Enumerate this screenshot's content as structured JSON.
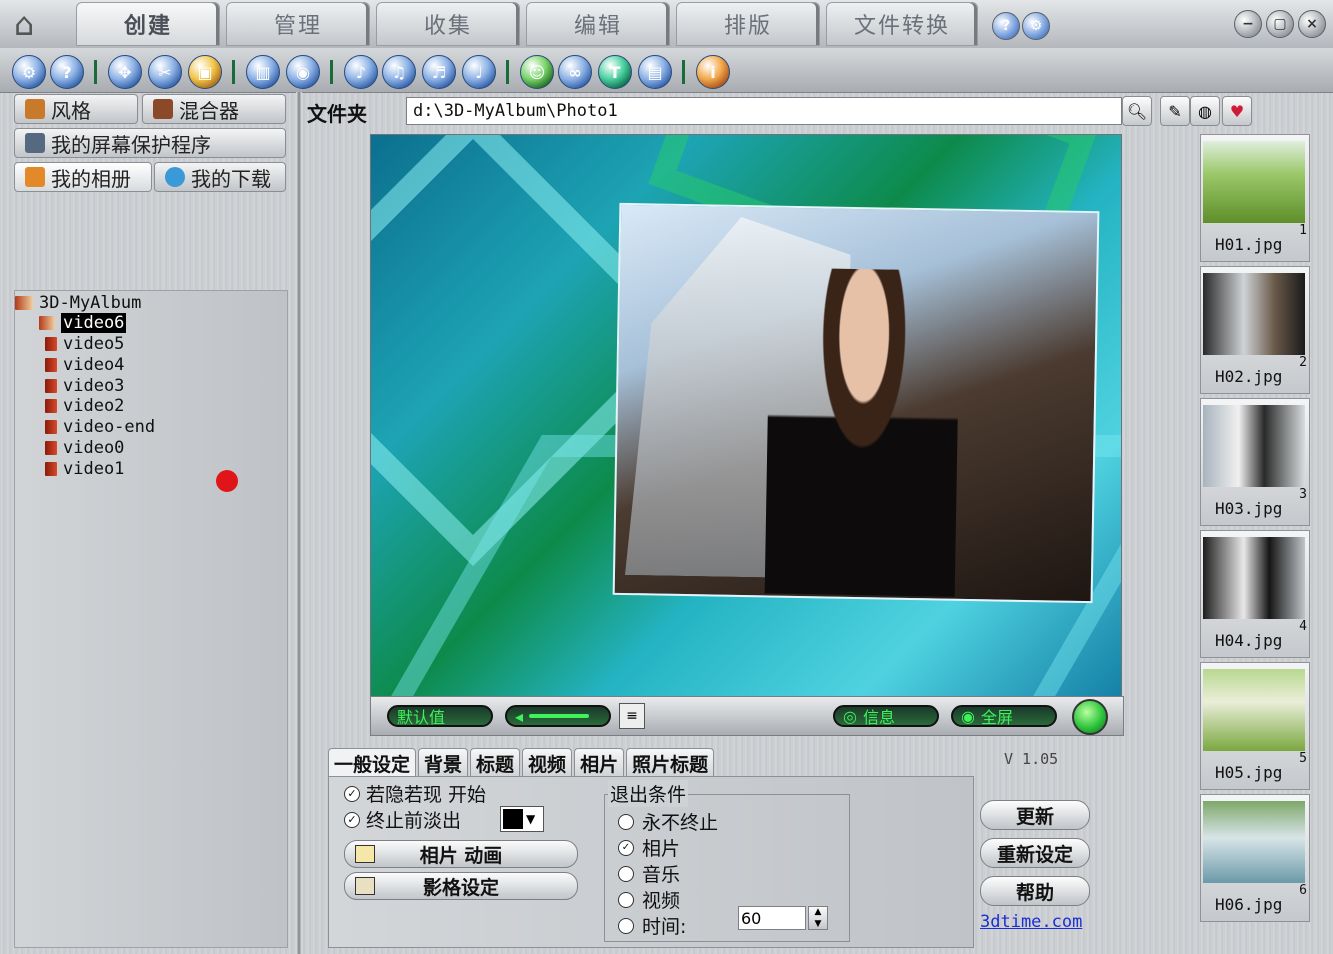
{
  "top_tabs": [
    "创建",
    "管理",
    "收集",
    "编辑",
    "排版",
    "文件转换"
  ],
  "left": {
    "btn_style": "风格",
    "btn_mixer": "混合器",
    "btn_screensaver": "我的屏幕保护程序",
    "btn_albums": "我的相册",
    "btn_downloads": "我的下载"
  },
  "tree": {
    "root": "3D-MyAlbum",
    "items": [
      "video6",
      "video5",
      "video4",
      "video3",
      "video2",
      "video-end",
      "video0",
      "video1"
    ],
    "selected": "video6"
  },
  "folder": {
    "label": "文件夹",
    "path": "d:\\3D-MyAlbum\\Photo1"
  },
  "player": {
    "default_label": "默认值",
    "info_label": "信息",
    "fullscreen_label": "全屏"
  },
  "settings": {
    "tabs": [
      "一般设定",
      "背景",
      "标题",
      "视频",
      "相片",
      "照片标题"
    ],
    "fade_in": "若隐若现 开始",
    "fade_out": "终止前淡出",
    "photo_anim": "相片 动画",
    "style_setting": "影格设定",
    "exit_title": "退出条件",
    "exit_options": [
      "永不终止",
      "相片",
      "音乐",
      "视频",
      "时间:"
    ],
    "time_value": "60"
  },
  "version": "V 1.05",
  "actions": {
    "update": "更新",
    "reset": "重新设定",
    "help": "帮助",
    "link": "3dtime.com"
  },
  "thumbnails": [
    {
      "name": "H01.jpg",
      "num": "1"
    },
    {
      "name": "H02.jpg",
      "num": "2"
    },
    {
      "name": "H03.jpg",
      "num": "3"
    },
    {
      "name": "H04.jpg",
      "num": "4"
    },
    {
      "name": "H05.jpg",
      "num": "5"
    },
    {
      "name": "H06.jpg",
      "num": "6"
    }
  ],
  "colors": {
    "link": "#1a2fd1",
    "player_led": "#3ef25a",
    "selection": "#000000"
  }
}
